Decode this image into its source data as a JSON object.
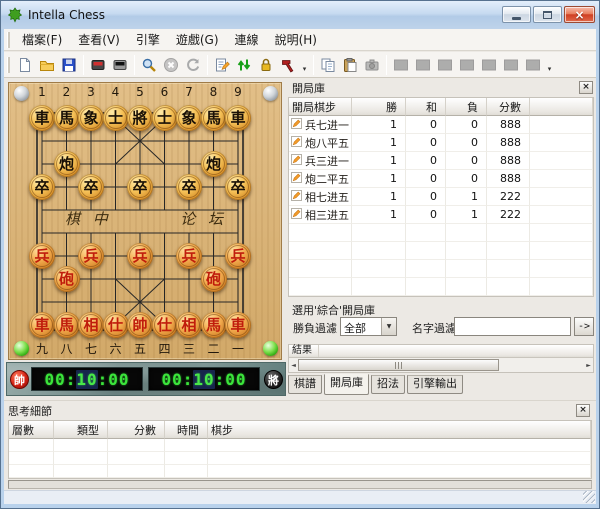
{
  "window": {
    "title": "Intella Chess"
  },
  "icons": {
    "close": "×",
    "dropdown": "▼",
    "scroll_left": "◄",
    "scroll_right": "►",
    "overflow": "▾"
  },
  "menu": {
    "items": [
      "檔案(F)",
      "查看(V)",
      "引擎",
      "遊戲(G)",
      "連線",
      "說明(H)"
    ]
  },
  "toolbar": {
    "buttons": [
      {
        "icon": "new-file",
        "enabled": true
      },
      {
        "icon": "open-file",
        "enabled": true
      },
      {
        "icon": "save-file",
        "enabled": true
      },
      {
        "sep": true
      },
      {
        "icon": "red-board",
        "enabled": true
      },
      {
        "icon": "black-board",
        "enabled": true
      },
      {
        "sep": true
      },
      {
        "icon": "search",
        "enabled": true
      },
      {
        "icon": "stop",
        "enabled": false
      },
      {
        "icon": "refresh",
        "enabled": false
      },
      {
        "sep": true
      },
      {
        "icon": "edit-notes",
        "enabled": true
      },
      {
        "icon": "swap-sides",
        "enabled": true
      },
      {
        "icon": "lock",
        "enabled": true
      },
      {
        "icon": "hammer",
        "enabled": true
      },
      {
        "overflow": true
      },
      {
        "sep": true
      },
      {
        "icon": "copy",
        "enabled": true
      },
      {
        "icon": "paste",
        "enabled": true
      },
      {
        "icon": "camera",
        "enabled": false
      },
      {
        "sep": true
      },
      {
        "icon": "slot",
        "enabled": false
      },
      {
        "icon": "slot",
        "enabled": false
      },
      {
        "icon": "slot",
        "enabled": false
      },
      {
        "icon": "slot",
        "enabled": false
      },
      {
        "icon": "slot",
        "enabled": false
      },
      {
        "icon": "slot",
        "enabled": false
      },
      {
        "icon": "slot",
        "enabled": false
      },
      {
        "overflow": true
      }
    ]
  },
  "board": {
    "top_numbers": [
      "1",
      "2",
      "3",
      "4",
      "5",
      "6",
      "7",
      "8",
      "9"
    ],
    "bottom_numbers": [
      "九",
      "八",
      "七",
      "六",
      "五",
      "四",
      "三",
      "二",
      "一"
    ],
    "river_left": "棋 中",
    "river_right": "论 坛",
    "pieces": [
      {
        "side": "black",
        "char": "車",
        "file": 1,
        "rank": 0
      },
      {
        "side": "black",
        "char": "馬",
        "file": 2,
        "rank": 0
      },
      {
        "side": "black",
        "char": "象",
        "file": 3,
        "rank": 0
      },
      {
        "side": "black",
        "char": "士",
        "file": 4,
        "rank": 0
      },
      {
        "side": "black",
        "char": "將",
        "file": 5,
        "rank": 0
      },
      {
        "side": "black",
        "char": "士",
        "file": 6,
        "rank": 0
      },
      {
        "side": "black",
        "char": "象",
        "file": 7,
        "rank": 0
      },
      {
        "side": "black",
        "char": "馬",
        "file": 8,
        "rank": 0
      },
      {
        "side": "black",
        "char": "車",
        "file": 9,
        "rank": 0
      },
      {
        "side": "black",
        "char": "炮",
        "file": 2,
        "rank": 2
      },
      {
        "side": "black",
        "char": "炮",
        "file": 8,
        "rank": 2
      },
      {
        "side": "black",
        "char": "卒",
        "file": 1,
        "rank": 3
      },
      {
        "side": "black",
        "char": "卒",
        "file": 3,
        "rank": 3
      },
      {
        "side": "black",
        "char": "卒",
        "file": 5,
        "rank": 3
      },
      {
        "side": "black",
        "char": "卒",
        "file": 7,
        "rank": 3
      },
      {
        "side": "black",
        "char": "卒",
        "file": 9,
        "rank": 3
      },
      {
        "side": "red",
        "char": "兵",
        "file": 1,
        "rank": 6
      },
      {
        "side": "red",
        "char": "兵",
        "file": 3,
        "rank": 6
      },
      {
        "side": "red",
        "char": "兵",
        "file": 5,
        "rank": 6
      },
      {
        "side": "red",
        "char": "兵",
        "file": 7,
        "rank": 6
      },
      {
        "side": "red",
        "char": "兵",
        "file": 9,
        "rank": 6
      },
      {
        "side": "red",
        "char": "砲",
        "file": 2,
        "rank": 7
      },
      {
        "side": "red",
        "char": "砲",
        "file": 8,
        "rank": 7
      },
      {
        "side": "red",
        "char": "車",
        "file": 1,
        "rank": 9
      },
      {
        "side": "red",
        "char": "馬",
        "file": 2,
        "rank": 9
      },
      {
        "side": "red",
        "char": "相",
        "file": 3,
        "rank": 9
      },
      {
        "side": "red",
        "char": "仕",
        "file": 4,
        "rank": 9
      },
      {
        "side": "red",
        "char": "帥",
        "file": 5,
        "rank": 9
      },
      {
        "side": "red",
        "char": "仕",
        "file": 6,
        "rank": 9
      },
      {
        "side": "red",
        "char": "相",
        "file": 7,
        "rank": 9
      },
      {
        "side": "red",
        "char": "馬",
        "file": 8,
        "rank": 9
      },
      {
        "side": "red",
        "char": "車",
        "file": 9,
        "rank": 9
      }
    ]
  },
  "clocks": {
    "red_badge": "帥",
    "red_h": "00",
    "red_m": "10",
    "red_s": "00",
    "black_badge": "將",
    "black_h": "00",
    "black_m": "10",
    "black_s": "00"
  },
  "opening": {
    "title": "開局庫",
    "columns": [
      "開局棋步",
      "勝",
      "和",
      "負",
      "分數"
    ],
    "rows": [
      {
        "move": "兵七进一",
        "win": "1",
        "draw": "0",
        "loss": "0",
        "score": "888"
      },
      {
        "move": "炮八平五",
        "win": "1",
        "draw": "0",
        "loss": "0",
        "score": "888"
      },
      {
        "move": "兵三进一",
        "win": "1",
        "draw": "0",
        "loss": "0",
        "score": "888"
      },
      {
        "move": "炮二平五",
        "win": "1",
        "draw": "0",
        "loss": "0",
        "score": "888"
      },
      {
        "move": "相七进五",
        "win": "1",
        "draw": "0",
        "loss": "1",
        "score": "222"
      },
      {
        "move": "相三进五",
        "win": "1",
        "draw": "0",
        "loss": "1",
        "score": "222"
      }
    ],
    "note": "選用'綜合'開局庫",
    "result_filter_label": "勝負過濾",
    "result_filter_value": "全部",
    "name_filter_label": "名字過濾",
    "name_filter_value": "",
    "go_label": "->",
    "results_header": "結果",
    "tabs": [
      "棋譜",
      "開局庫",
      "招法",
      "引擎輸出"
    ],
    "active_tab": "開局庫"
  },
  "think": {
    "title": "思考細節",
    "columns": [
      "層數",
      "類型",
      "分數",
      "時間",
      "棋步"
    ]
  }
}
